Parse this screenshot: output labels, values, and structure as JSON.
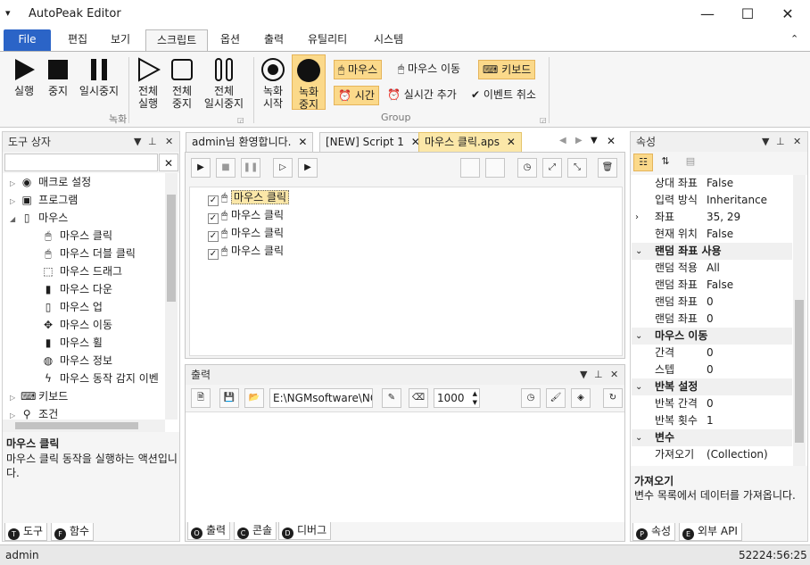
{
  "window": {
    "title": "AutoPeak Editor",
    "minimize": "—",
    "maximize": "☐",
    "close": "✕",
    "sysmenu": "▾"
  },
  "ribbon_tabs": [
    "File",
    "편집",
    "보기",
    "스크립트",
    "옵션",
    "출력",
    "유틸리티",
    "시스템"
  ],
  "ribbon": {
    "run": "실행",
    "stop": "중지",
    "pause": "일시중지",
    "run_all_1": "전체",
    "run_all_2": "실행",
    "stop_all_1": "전체",
    "stop_all_2": "중지",
    "pause_all_1": "전체",
    "pause_all_2": "일시중지",
    "record_start_1": "녹화",
    "record_start_2": "시작",
    "record_stop_1": "녹화",
    "record_stop_2": "중지",
    "group_record": "녹화",
    "group_group": "Group",
    "mouse": "마우스",
    "mouse_move": "마우스 이동",
    "keyboard": "키보드",
    "time": "시간",
    "realtime_add": "실시간 추가",
    "event_cancel": "이벤트 취소"
  },
  "toolbox": {
    "title": "도구 상자",
    "items": [
      "매크로 설정",
      "프로그램",
      "마우스",
      "마우스 클릭",
      "마우스 더블 클릭",
      "마우스 드래그",
      "마우스 다운",
      "마우스 업",
      "마우스 이동",
      "마우스 휠",
      "마우스 정보",
      "마우스 동작 감지 이벤",
      "키보드",
      "조건"
    ],
    "desc_title": "마우스 클릭",
    "desc_text": "마우스 클릭 동작을 실행하는 액션입니다.",
    "tab_tools": "도구",
    "tab_funcs": "함수"
  },
  "doc_tabs": [
    "admin님 환영합니다.",
    "[NEW] Script 1",
    "마우스 클릭.aps"
  ],
  "script_lines": [
    "마우스 클릭",
    "마우스 클릭",
    "마우스 클릭",
    "마우스 클릭"
  ],
  "output": {
    "title": "출력",
    "path": "E:\\NGMsoftware\\NG",
    "count": "1000",
    "tab_output": "출력",
    "tab_console": "콘솔",
    "tab_debug": "디버그"
  },
  "properties": {
    "title": "속성",
    "rows": [
      {
        "k": "상대 좌표",
        "v": "False"
      },
      {
        "k": "입력 방식",
        "v": "Inheritance"
      },
      {
        "k": "좌표",
        "v": "35, 29"
      },
      {
        "k": "현재 위치",
        "v": "False"
      },
      {
        "cat": "랜덤 좌표 사용"
      },
      {
        "k": "랜덤 적용",
        "v": "All"
      },
      {
        "k": "랜덤 좌표",
        "v": "False"
      },
      {
        "k": "랜덤 좌표",
        "v": "0"
      },
      {
        "k": "랜덤 좌표",
        "v": "0"
      },
      {
        "cat": "마우스 이동"
      },
      {
        "k": "간격",
        "v": "0"
      },
      {
        "k": "스텝",
        "v": "0"
      },
      {
        "cat": "반복 설정"
      },
      {
        "k": "반복 간격",
        "v": "0"
      },
      {
        "k": "반복 횟수",
        "v": "1"
      },
      {
        "cat": "변수"
      },
      {
        "k": "가져오기",
        "v": "(Collection)"
      }
    ],
    "desc_title": "가져오기",
    "desc_text": "변수 목록에서 데이터를 가져옵니다.",
    "tab_props": "속성",
    "tab_api": "외부 API"
  },
  "status": {
    "user": "admin",
    "time": "52224:56:25"
  },
  "colors": {
    "file_tab": "#2b64c7",
    "highlight": "#fbd98a",
    "active_doc_tab": "#fbe7a8"
  }
}
